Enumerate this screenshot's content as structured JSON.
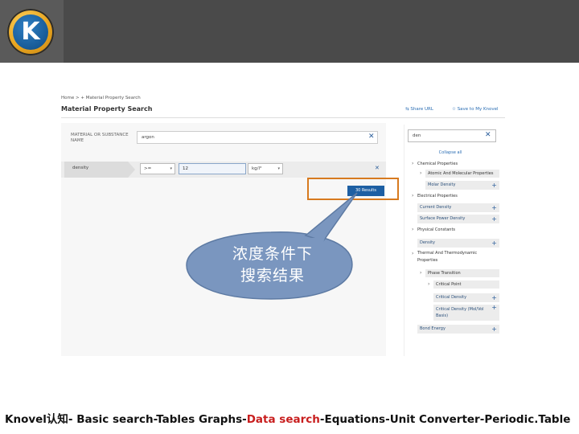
{
  "header": {
    "logo_letter": "K",
    "logo_name": "knovel-logo"
  },
  "panel": {
    "breadcrumb": "Home > + Material Property Search",
    "title": "Material Property Search",
    "share_label": "Share URL",
    "save_label": "Save to My Knovel",
    "material_label": "MATERIAL OR SUBSTANCE NAME",
    "material_value": "argon",
    "property_name": "density",
    "operator_value": ">=",
    "value_input": "12",
    "unit_value": "kg/l³",
    "results_label": "30 Results",
    "highlight_color": "#d77a1f",
    "button_color": "#1d5fa3"
  },
  "sidebar": {
    "search_value": "den",
    "collapse_label": "Collapse all",
    "tree": [
      {
        "label": "Chemical Properties",
        "kind": "group",
        "level": 0
      },
      {
        "label": "Atomic And Molecular Properties",
        "kind": "subgroup",
        "level": 1
      },
      {
        "label": "Molar Density",
        "kind": "leaf",
        "level": 1
      },
      {
        "label": "Electrical Properties",
        "kind": "group",
        "level": 0
      },
      {
        "label": "Current Density",
        "kind": "leaf",
        "level": 0
      },
      {
        "label": "Surface Power Density",
        "kind": "leaf",
        "level": 0
      },
      {
        "label": "Physical Constants",
        "kind": "group",
        "level": 0
      },
      {
        "label": "Density",
        "kind": "leaf",
        "level": 0
      },
      {
        "label": "Thermal And Thermodynamic Properties",
        "kind": "group",
        "level": 0
      },
      {
        "label": "Phase Transition",
        "kind": "subgroup",
        "level": 1
      },
      {
        "label": "Critical Point",
        "kind": "subgroup",
        "level": 2
      },
      {
        "label": "Critical Density",
        "kind": "leaf",
        "level": 2
      },
      {
        "label": "Critical Density (Mol/Vol Basis)",
        "kind": "leaf",
        "level": 2
      },
      {
        "label": "Bond Energy",
        "kind": "leaf",
        "level": 0
      }
    ]
  },
  "callout": {
    "line1": "浓度条件下",
    "line2": "搜索结果",
    "fill_color": "#7a96bf"
  },
  "footer": {
    "part1": "Knovel认知- Basic search-Tables Graphs-",
    "part2": "Data search",
    "part3": "-Equations-Unit Converter-Periodic.Table"
  }
}
